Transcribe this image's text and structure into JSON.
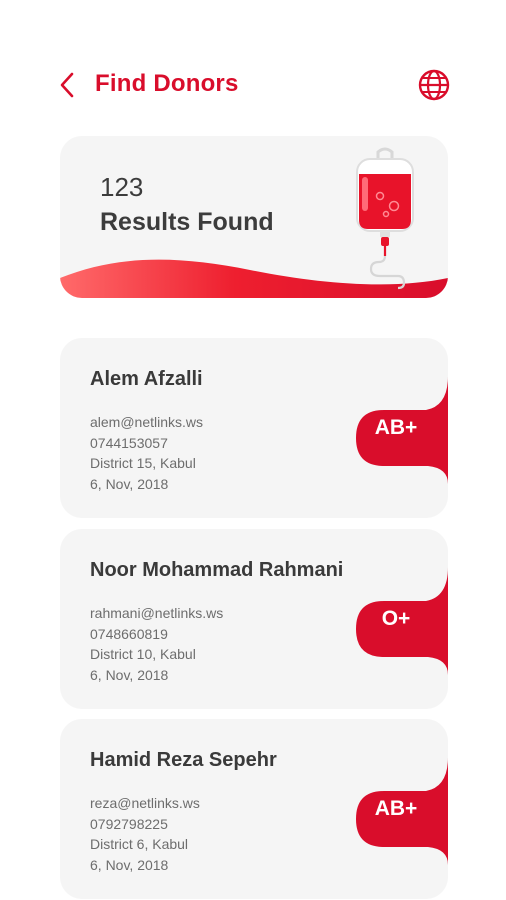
{
  "header": {
    "title": "Find Donors",
    "back_icon": "chevron-left-icon",
    "globe_icon": "globe-icon"
  },
  "summary": {
    "count": "123",
    "label": "Results Found",
    "illustration": "blood-bag-icon"
  },
  "donors": [
    {
      "name": "Alem Afzalli",
      "email": "alem@netlinks.ws",
      "phone": "0744153057",
      "address": "District 15, Kabul",
      "date": "6, Nov, 2018",
      "blood_type": "AB+"
    },
    {
      "name": "Noor Mohammad Rahmani",
      "email": "rahmani@netlinks.ws",
      "phone": "0748660819",
      "address": "District 10, Kabul",
      "date": "6, Nov, 2018",
      "blood_type": "O+"
    },
    {
      "name": "Hamid Reza Sepehr",
      "email": "reza@netlinks.ws",
      "phone": "0792798225",
      "address": "District 6, Kabul",
      "date": "6, Nov, 2018",
      "blood_type": "AB+"
    }
  ],
  "colors": {
    "accent": "#d90d2b",
    "card_bg": "#f5f5f5",
    "text": "#3c3c3c",
    "muted_text": "#6d6d6d"
  }
}
